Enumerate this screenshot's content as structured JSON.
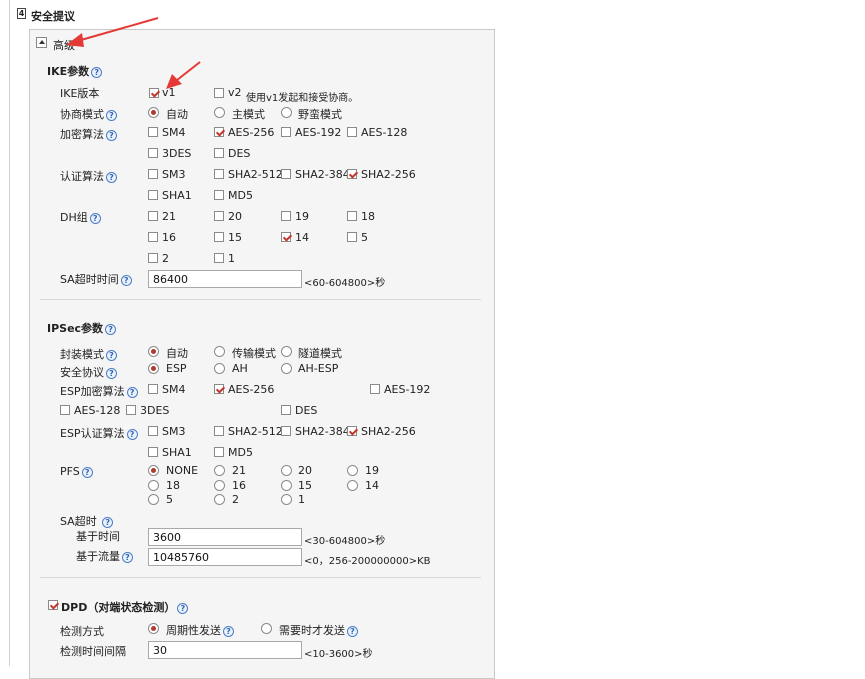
{
  "section_title": "安全提议",
  "advanced_label": "高级",
  "ike": {
    "title": "IKE参数",
    "version": {
      "label": "IKE版本",
      "v1": "v1",
      "v2": "v2",
      "v2_note": "使用v1发起和接受协商。"
    },
    "neg_mode": {
      "label": "协商模式",
      "options": [
        "自动",
        "主模式",
        "野蛮模式"
      ]
    },
    "enc": {
      "label": "加密算法",
      "options": [
        "SM4",
        "AES-256",
        "AES-192",
        "AES-128",
        "3DES",
        "DES"
      ]
    },
    "auth": {
      "label": "认证算法",
      "options": [
        "SM3",
        "SHA2-512",
        "SHA2-384",
        "SHA2-256",
        "SHA1",
        "MD5"
      ]
    },
    "dh": {
      "label": "DH组",
      "options": [
        "21",
        "20",
        "19",
        "18",
        "16",
        "15",
        "14",
        "5",
        "2",
        "1"
      ]
    },
    "sa_timeout": {
      "label": "SA超时时间",
      "value": "86400",
      "hint": "<60-604800>秒"
    }
  },
  "ipsec": {
    "title": "IPSec参数",
    "encap": {
      "label": "封装模式",
      "options": [
        "自动",
        "传输模式",
        "隧道模式"
      ]
    },
    "proto": {
      "label": "安全协议",
      "options": [
        "ESP",
        "AH",
        "AH-ESP"
      ]
    },
    "esp_enc": {
      "label": "ESP加密算法",
      "options": [
        "SM4",
        "AES-256",
        "AES-192",
        "AES-128",
        "3DES",
        "DES"
      ]
    },
    "esp_auth": {
      "label": "ESP认证算法",
      "options": [
        "SM3",
        "SHA2-512",
        "SHA2-384",
        "SHA2-256",
        "SHA1",
        "MD5"
      ]
    },
    "pfs": {
      "label": "PFS",
      "options": [
        "NONE",
        "21",
        "20",
        "19",
        "18",
        "16",
        "15",
        "14",
        "5",
        "2",
        "1"
      ]
    },
    "sa_timeout": {
      "label": "SA超时",
      "time_label": "基于时间",
      "time_value": "3600",
      "time_hint": "<30-604800>秒",
      "traffic_label": "基于流量",
      "traffic_value": "10485760",
      "traffic_hint": "<0，256-200000000>KB"
    }
  },
  "dpd": {
    "title": "DPD（对端状态检测）",
    "detect": {
      "label": "检测方式",
      "options": [
        "周期性发送",
        "需要时才发送"
      ]
    },
    "interval": {
      "label": "检测时间间隔",
      "value": "30",
      "hint": "<10-3600>秒"
    }
  },
  "colors": {
    "accent_red": "#e53935",
    "check": "#c0392b",
    "help_blue": "#3565b0"
  }
}
